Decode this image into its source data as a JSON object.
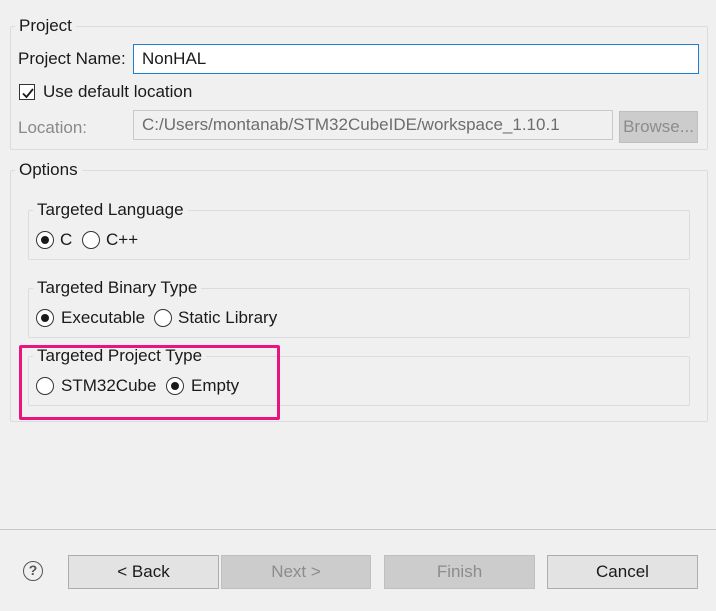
{
  "project": {
    "group_label": "Project",
    "name_label": "Project Name:",
    "name_value": "NonHAL",
    "default_location_label": "Use default location",
    "default_location_checked": true,
    "location_label": "Location:",
    "location_value": "C:/Users/montanab/STM32CubeIDE/workspace_1.10.1",
    "browse_label": "Browse..."
  },
  "options": {
    "group_label": "Options",
    "language": {
      "label": "Targeted Language",
      "choices": [
        "C",
        "C++"
      ],
      "selected": "C"
    },
    "binary": {
      "label": "Targeted Binary Type",
      "choices": [
        "Executable",
        "Static Library"
      ],
      "selected": "Executable"
    },
    "project_type": {
      "label": "Targeted Project Type",
      "choices": [
        "STM32Cube",
        "Empty"
      ],
      "selected": "Empty"
    }
  },
  "footer": {
    "help_icon": "?",
    "back_label": "< Back",
    "next_label": "Next >",
    "finish_label": "Finish",
    "cancel_label": "Cancel"
  },
  "colors": {
    "highlight": "#e8157f",
    "focus_border": "#1e7bd6",
    "background": "#f0f0f0"
  }
}
